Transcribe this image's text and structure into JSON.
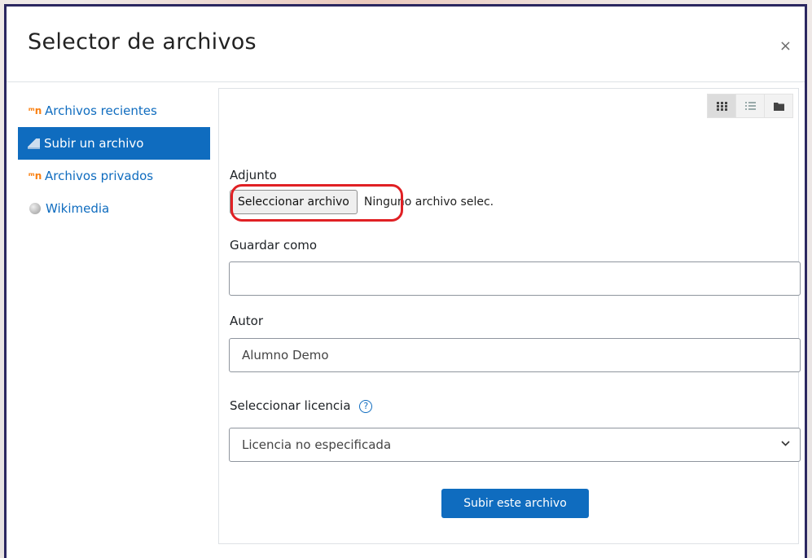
{
  "dialog": {
    "title": "Selector de archivos",
    "close_label": "×"
  },
  "sidebar": {
    "items": [
      {
        "label": "Archivos recientes",
        "icon": "moodle-icon",
        "active": false
      },
      {
        "label": "Subir un archivo",
        "icon": "upload-icon",
        "active": true
      },
      {
        "label": "Archivos privados",
        "icon": "moodle-icon",
        "active": false
      },
      {
        "label": "Wikimedia",
        "icon": "wikimedia-icon",
        "active": false
      }
    ]
  },
  "viewbar": {
    "icons": [
      "grid-view-icon",
      "list-view-icon",
      "folder-view-icon"
    ],
    "active": "grid-view-icon"
  },
  "form": {
    "attachment_label": "Adjunto",
    "file_button_label": "Seleccionar archivo",
    "file_status": "Ninguno archivo selec.",
    "save_as_label": "Guardar como",
    "save_as_value": "",
    "author_label": "Autor",
    "author_value": "Alumno Demo",
    "license_label": "Seleccionar licencia",
    "license_help": "?",
    "license_value": "Licencia no especificada",
    "submit_label": "Subir este archivo"
  },
  "colors": {
    "primary": "#0f6cbf",
    "highlight": "#e02024",
    "moodle_orange": "#f98012"
  }
}
